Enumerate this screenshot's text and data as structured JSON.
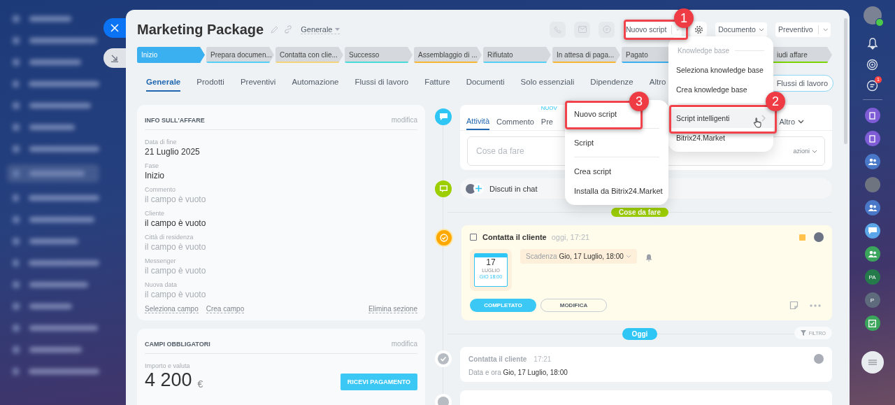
{
  "header": {
    "title": "Marketing Package",
    "category": "Generale",
    "script_button": "Nuovo script",
    "document_button": "Documento",
    "quote_button": "Preventivo"
  },
  "stages": [
    {
      "label": "Inizio",
      "selected": true,
      "color": "#3bb0f0"
    },
    {
      "label": "Prepara documen...",
      "selected": false,
      "color": "#55d0f5"
    },
    {
      "label": "Contatta con clie...",
      "selected": false,
      "color": "#f5d47a"
    },
    {
      "label": "Successo",
      "selected": false,
      "color": "#47dcd9"
    },
    {
      "label": "Assemblaggio di ...",
      "selected": false,
      "color": "#f7b733"
    },
    {
      "label": "Rifiutato",
      "selected": false,
      "color": "#55d0f5"
    },
    {
      "label": "In attesa di paga...",
      "selected": false,
      "color": "#f7b733"
    },
    {
      "label": "Pagato",
      "selected": false,
      "color": "#3bb0f0"
    },
    {
      "label": "iudi affare",
      "selected": false,
      "color": "#7bd500"
    }
  ],
  "tabs": [
    {
      "label": "Generale",
      "selected": true
    },
    {
      "label": "Prodotti",
      "selected": false
    },
    {
      "label": "Preventivi",
      "selected": false
    },
    {
      "label": "Automazione",
      "selected": false
    },
    {
      "label": "Flussi di lavoro",
      "selected": false
    },
    {
      "label": "Fatture",
      "selected": false
    },
    {
      "label": "Documenti",
      "selected": false
    },
    {
      "label": "Solo essenziali",
      "selected": false
    },
    {
      "label": "Dipendenze",
      "selected": false
    },
    {
      "label": "Altro",
      "selected": false
    }
  ],
  "workflow_button": "Flussi di lavoro",
  "info_card": {
    "title": "INFO SULL'AFFARE",
    "edit": "modifica",
    "fields": [
      {
        "label": "Data di fine",
        "value": "21 Luglio 2025",
        "muted": false
      },
      {
        "label": "Fase",
        "value": "Inizio",
        "muted": false
      },
      {
        "label": "Commento",
        "value": "il campo è vuoto",
        "muted": true
      },
      {
        "label": "Cliente",
        "value": "il campo è vuoto",
        "muted": false
      },
      {
        "label": "Città di residenza",
        "value": "il campo è vuoto",
        "muted": true
      },
      {
        "label": "Messenger",
        "value": "il campo è vuoto",
        "muted": true
      },
      {
        "label": "Nuova data",
        "value": "il campo è vuoto",
        "muted": true
      }
    ],
    "links": [
      "Seleziona campo",
      "Crea campo"
    ],
    "delete": "Elimina sezione"
  },
  "required_card": {
    "title": "CAMPI OBBLIGATORI",
    "edit": "modifica",
    "field_label": "Importo e valuta",
    "amount": "4 200",
    "currency": "€",
    "pay_button": "RICEVI PAGAMENTO"
  },
  "activity": {
    "tabs": [
      {
        "label": "Attività",
        "selected": true
      },
      {
        "label": "Commento",
        "selected": false
      },
      {
        "label": "Pre",
        "selected": false,
        "badge": "NUOV"
      },
      {
        "label": "Altro",
        "selected": false
      }
    ],
    "placeholder": "Cose da fare",
    "actions": "azioni"
  },
  "chat": {
    "label": "Discuti in chat"
  },
  "todo_divider": "Cose da fare",
  "task": {
    "title": "Contatta il cliente",
    "time": "oggi, 17:21",
    "done": false,
    "calendar": {
      "day": "17",
      "month": "LUGLIO",
      "time": "GIO 18:00"
    },
    "deadline_label": "Scadenza",
    "deadline": "Gio, 17 Luglio, 18:00",
    "complete_button": "COMPLETATO",
    "edit_button": "MODIFICA"
  },
  "today_divider": "Oggi",
  "filter": "FILTRO",
  "history": [
    {
      "title": "Contatta il cliente",
      "time": "17:21",
      "detail_label": "Data e ora",
      "detail": "Gio, 17 Luglio, 18:00"
    }
  ],
  "script_menu": {
    "header": "Knowledge base",
    "sections": [
      [
        {
          "label": "Seleziona knowledge base",
          "has_submenu": false,
          "highlighted": false
        },
        {
          "label": "Crea knowledge base",
          "has_submenu": false,
          "highlighted": false
        }
      ],
      [
        {
          "label": "Script intelligenti",
          "has_submenu": true,
          "highlighted": true
        },
        {
          "label": "Bitrix24.Market",
          "has_submenu": false,
          "highlighted": false
        }
      ]
    ]
  },
  "submenu": {
    "sections": [
      [
        {
          "label": "Nuovo script",
          "highlighted": false
        }
      ],
      [
        {
          "label": "Script",
          "highlighted": false
        }
      ],
      [
        {
          "label": "Crea script",
          "highlighted": false
        },
        {
          "label": "Installa da Bitrix24.Market",
          "highlighted": false
        }
      ]
    ]
  },
  "annotations": [
    {
      "number": "1"
    },
    {
      "number": "2"
    },
    {
      "number": "3"
    }
  ],
  "right_bar": {
    "chat_badge": "1",
    "avatars": [
      "PA",
      "P"
    ]
  }
}
